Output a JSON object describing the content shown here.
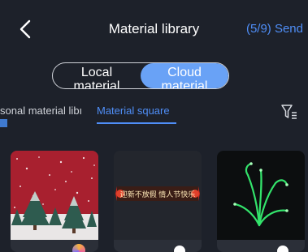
{
  "header": {
    "title": "Material library",
    "send_label": "(5/9) Send",
    "accent_color": "#4f8ef7"
  },
  "source_toggle": {
    "options": [
      {
        "label": "Local\nmaterial",
        "selected": false
      },
      {
        "label": "Cloud\nmaterial",
        "selected": true
      }
    ],
    "selected_color": "#69a2f6"
  },
  "tabs": {
    "items": [
      {
        "label": "Personal material library",
        "visible_text": "sonal material libı",
        "active": false
      },
      {
        "label": "Material square",
        "active": true
      }
    ]
  },
  "filter": {
    "icon": "filter-icon"
  },
  "materials": [
    {
      "name": "snowy-christmas-trees",
      "badge": "gradient-circle"
    },
    {
      "name": "banner",
      "text": "迎新不放假 情人节快乐",
      "badge": "white-dot"
    },
    {
      "name": "green-firework",
      "badge": "white-dot"
    }
  ]
}
